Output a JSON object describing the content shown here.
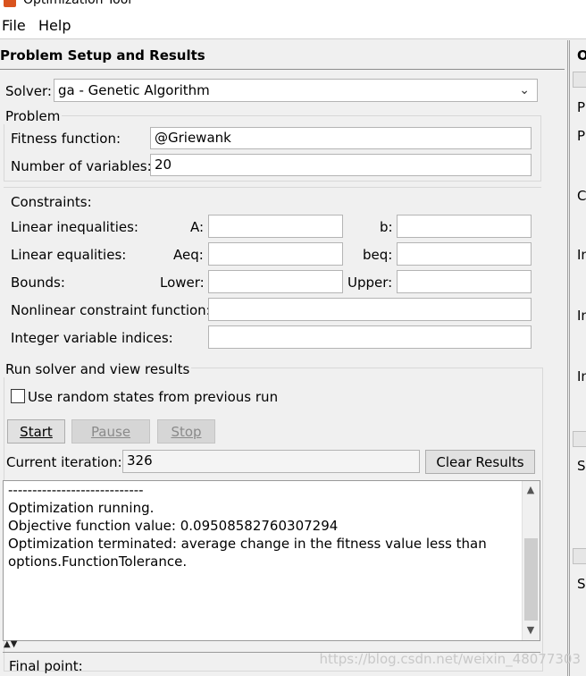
{
  "window": {
    "title": "Optimization Tool"
  },
  "menu": {
    "file": "File",
    "help": "Help"
  },
  "left_panel": {
    "header": "Problem Setup and Results",
    "solver": {
      "label": "Solver:",
      "value": "ga - Genetic Algorithm"
    },
    "problem": {
      "group_label": "Problem",
      "fitness_label": "Fitness function:",
      "fitness_value": "@Griewank",
      "numvars_label": "Number of variables:",
      "numvars_value": "20"
    },
    "constraints": {
      "label": "Constraints:",
      "linear_ineq_label": "Linear inequalities:",
      "a_label": "A:",
      "b_label": "b:",
      "linear_eq_label": "Linear equalities:",
      "aeq_label": "Aeq:",
      "beq_label": "beq:",
      "bounds_label": "Bounds:",
      "lower_label": "Lower:",
      "upper_label": "Upper:",
      "nonlinear_label": "Nonlinear constraint function:",
      "integer_label": "Integer variable indices:"
    },
    "run": {
      "group_label": "Run solver and view results",
      "random_states_label": "Use random states from previous run",
      "random_states_checked": false,
      "start_label": "Start",
      "pause_label": "Pause",
      "stop_label": "Stop",
      "current_iteration_label": "Current iteration:",
      "current_iteration_value": "326",
      "clear_results_label": "Clear Results",
      "output_lines": [
        "----------------------------",
        "Optimization running.",
        "Objective function value: 0.09508582760307294",
        "Optimization terminated: average change in the fitness value less than",
        "options.FunctionTolerance."
      ]
    },
    "final_point_label": "Final point:"
  },
  "right_panel": {
    "header_fragment": "O",
    "fragments": [
      "P",
      "P",
      "C",
      "In",
      "In",
      "In",
      "S",
      "S"
    ]
  },
  "watermark": "https://blog.csdn.net/weixin_48077303"
}
